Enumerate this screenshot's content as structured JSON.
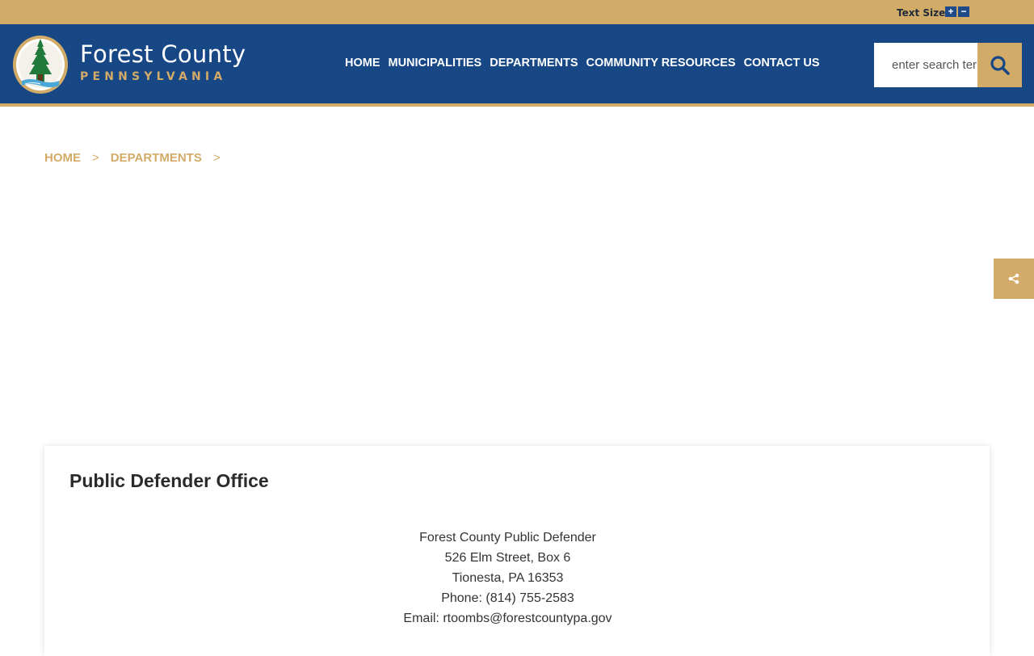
{
  "top_bar": {
    "text_size_label": "Text Size",
    "increase_label": "+",
    "decrease_label": "−"
  },
  "header": {
    "logo_title": "Forest County",
    "logo_subtitle": "PENNSYLVANIA",
    "nav": [
      {
        "label": "HOME"
      },
      {
        "label": "MUNICIPALITIES"
      },
      {
        "label": "DEPARTMENTS"
      },
      {
        "label": "COMMUNITY RESOURCES"
      },
      {
        "label": "CONTACT US"
      }
    ],
    "search": {
      "placeholder": "enter search terms",
      "icon": "search-icon"
    }
  },
  "breadcrumb": {
    "items": [
      {
        "label": "HOME"
      },
      {
        "label": "DEPARTMENTS"
      }
    ],
    "separator": ">"
  },
  "share": {
    "icon": "share-icon"
  },
  "content": {
    "title": "Public Defender Office",
    "contact_lines": [
      "Forest County Public Defender",
      "526 Elm Street, Box 6",
      "Tionesta, PA 16353",
      "Phone: (814) 755-2583",
      "Email: rtoombs@forestcountypa.gov"
    ]
  },
  "colors": {
    "gold": "#d3ab68",
    "navy": "#174785",
    "white": "#ffffff"
  }
}
